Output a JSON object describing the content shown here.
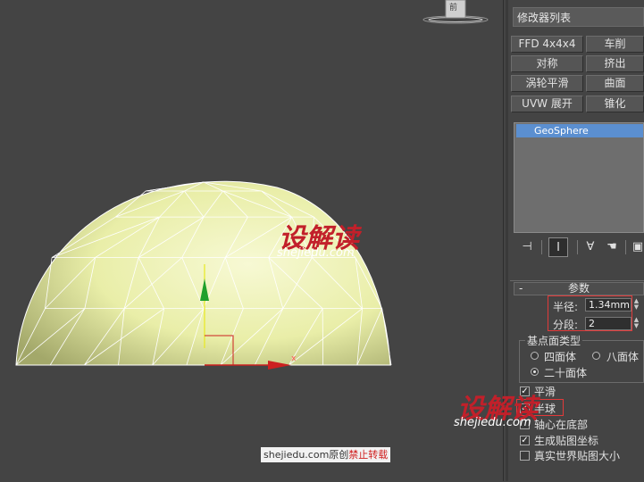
{
  "viewport": {
    "viewcube_label": "前",
    "axis_x_label": "x"
  },
  "panel": {
    "modifier_list": "修改器列表",
    "buttons": [
      {
        "label": "FFD 4x4x4"
      },
      {
        "label": "车削"
      },
      {
        "label": "对称"
      },
      {
        "label": "挤出"
      },
      {
        "label": "涡轮平滑"
      },
      {
        "label": "曲面"
      },
      {
        "label": "UVW 展开"
      },
      {
        "label": "锥化"
      }
    ],
    "stack_item": "GeoSphere",
    "stack_tools": [
      "pin-stack-icon",
      "show-end-result-icon",
      "make-unique-icon",
      "remove-modifier-icon",
      "configure-sets-icon"
    ]
  },
  "params": {
    "title": "参数",
    "collapse_symbol": "-",
    "radius_label": "半径:",
    "radius_value": "1.34mm",
    "segments_label": "分段:",
    "segments_value": "2",
    "base_type_label": "基点面类型",
    "tetra_label": "四面体",
    "octa_label": "八面体",
    "icosa_label": "二十面体",
    "smooth_label": "平滑",
    "hemisphere_label": "半球",
    "base_pivot_label": "轴心在底部",
    "gen_map_label": "生成贴图坐标",
    "real_world_label": "真实世界贴图大小"
  },
  "watermark": {
    "cn_text": "设解读",
    "en_text": "shejiedu.com",
    "credit_text": "shejiedu.com原创",
    "credit_warning": "禁止转载"
  },
  "colors": {
    "background": "#444444",
    "mesh_fill": "#f0f3b4",
    "selection_blue": "#5b8fd0",
    "highlight_red": "#e23a3a"
  }
}
